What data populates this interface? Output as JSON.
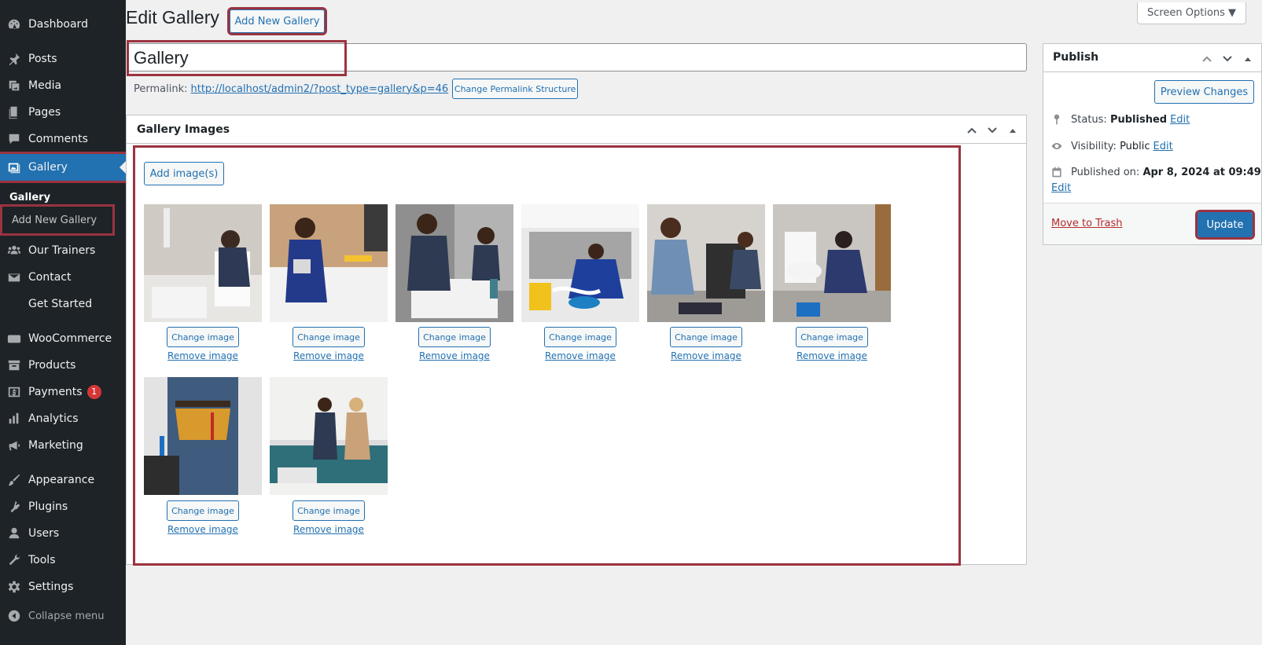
{
  "sidebar": {
    "items": [
      {
        "label": "Dashboard",
        "icon": "dashboard-icon"
      },
      {
        "label": "Posts",
        "icon": "pin-icon"
      },
      {
        "label": "Media",
        "icon": "media-icon"
      },
      {
        "label": "Pages",
        "icon": "pages-icon"
      },
      {
        "label": "Comments",
        "icon": "comments-icon"
      },
      {
        "label": "Gallery",
        "icon": "gallery-icon"
      },
      {
        "label": "Our Trainers",
        "icon": "groups-icon"
      },
      {
        "label": "Contact",
        "icon": "email-icon"
      },
      {
        "label": "Get Started",
        "icon": ""
      },
      {
        "label": "WooCommerce",
        "icon": "woo-icon"
      },
      {
        "label": "Products",
        "icon": "archive-icon"
      },
      {
        "label": "Payments",
        "icon": "payments-icon",
        "badge": "1"
      },
      {
        "label": "Analytics",
        "icon": "chart-bar-icon"
      },
      {
        "label": "Marketing",
        "icon": "megaphone-icon"
      },
      {
        "label": "Appearance",
        "icon": "brush-icon"
      },
      {
        "label": "Plugins",
        "icon": "plugin-icon"
      },
      {
        "label": "Users",
        "icon": "user-icon"
      },
      {
        "label": "Tools",
        "icon": "wrench-icon"
      },
      {
        "label": "Settings",
        "icon": "settings-icon"
      },
      {
        "label": "Collapse menu",
        "icon": "collapse-icon"
      }
    ],
    "submenu": {
      "gallery": "Gallery",
      "add_new": "Add New Gallery"
    }
  },
  "header": {
    "title": "Edit Gallery",
    "add_new_label": "Add New Gallery",
    "screen_options": "Screen Options ▼"
  },
  "post": {
    "title_value": "Gallery",
    "permalink_label": "Permalink:",
    "permalink_url": "http://localhost/admin2/?post_type=gallery&p=46",
    "change_permalink_label": "Change Permalink Structure"
  },
  "gallery_box": {
    "title": "Gallery Images",
    "add_images_label": "Add image(s)",
    "change_label": "Change image",
    "remove_label": "Remove image",
    "images": [
      "plumber at sink and toilet",
      "plumber with clipboard in kitchen",
      "plumber fixing bathroom faucet",
      "plumber under kitchen sink",
      "technician repairing dishwasher",
      "plumber repairing toilet",
      "worker with tool belt",
      "plumber and client in kitchen"
    ]
  },
  "publish": {
    "title": "Publish",
    "preview_label": "Preview Changes",
    "status_label": "Status:",
    "status_value": "Published",
    "visibility_label": "Visibility:",
    "visibility_value": "Public",
    "published_label": "Published on:",
    "published_value": "Apr 8, 2024 at 09:49",
    "edit_label": "Edit",
    "trash_label": "Move to Trash",
    "update_label": "Update"
  },
  "colors": {
    "sidebar_bg": "#1d2327",
    "accent": "#2271b1",
    "highlight": "#9b3340",
    "badge": "#d63638"
  }
}
